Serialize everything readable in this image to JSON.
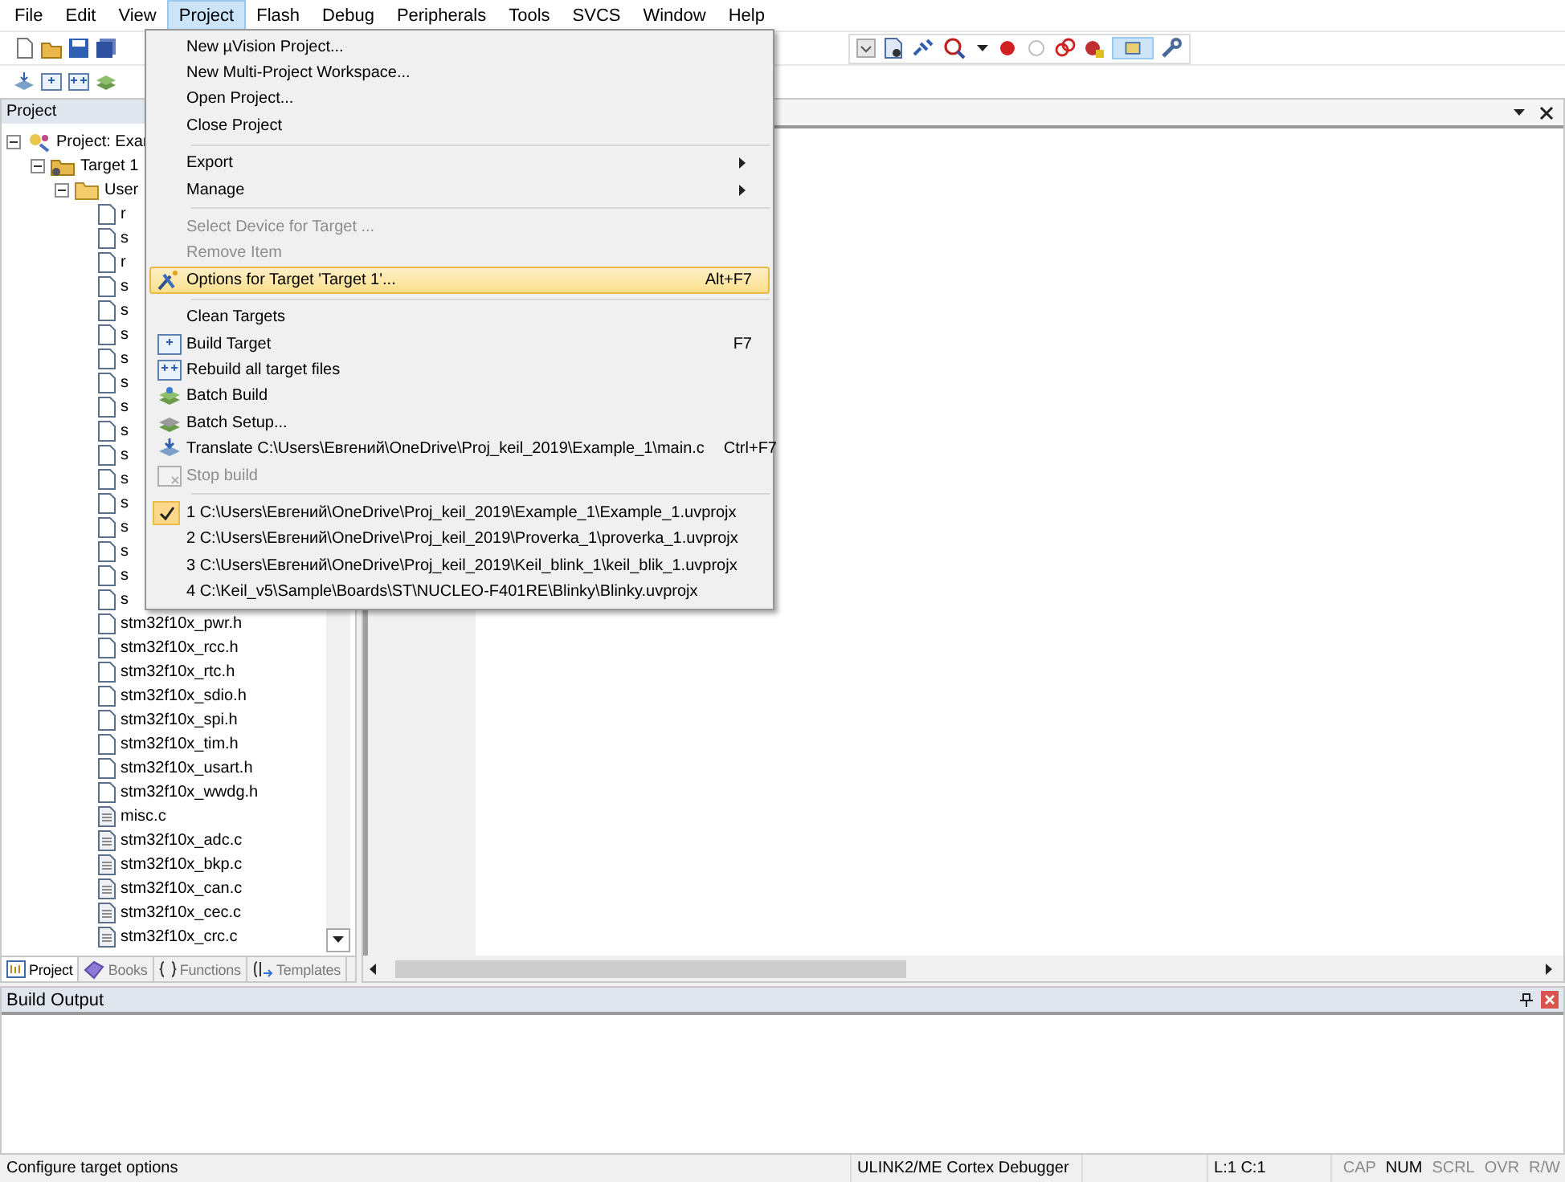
{
  "menubar": [
    {
      "label": "File",
      "selected": false
    },
    {
      "label": "Edit",
      "selected": false
    },
    {
      "label": "View",
      "selected": false
    },
    {
      "label": "Project",
      "selected": true
    },
    {
      "label": "Flash",
      "selected": false
    },
    {
      "label": "Debug",
      "selected": false
    },
    {
      "label": "Peripherals",
      "selected": false
    },
    {
      "label": "Tools",
      "selected": false
    },
    {
      "label": "SVCS",
      "selected": false
    },
    {
      "label": "Window",
      "selected": false
    },
    {
      "label": "Help",
      "selected": false
    }
  ],
  "project_panel": {
    "title": "Project",
    "tree": [
      {
        "label": "Project: Exar",
        "expanded": true,
        "kind": "project",
        "children": [
          {
            "label": "Target 1",
            "expanded": true,
            "kind": "target",
            "children": [
              {
                "label": "User",
                "expanded": true,
                "kind": "folder",
                "children": [
                  {
                    "label": "r",
                    "kind": "h"
                  },
                  {
                    "label": "s",
                    "kind": "h"
                  },
                  {
                    "label": "r",
                    "kind": "h"
                  },
                  {
                    "label": "s",
                    "kind": "h"
                  },
                  {
                    "label": "s",
                    "kind": "h"
                  },
                  {
                    "label": "s",
                    "kind": "h"
                  },
                  {
                    "label": "s",
                    "kind": "h"
                  },
                  {
                    "label": "s",
                    "kind": "h"
                  },
                  {
                    "label": "s",
                    "kind": "h"
                  },
                  {
                    "label": "s",
                    "kind": "h"
                  },
                  {
                    "label": "s",
                    "kind": "h"
                  },
                  {
                    "label": "s",
                    "kind": "h"
                  },
                  {
                    "label": "s",
                    "kind": "h"
                  },
                  {
                    "label": "s",
                    "kind": "h"
                  },
                  {
                    "label": "s",
                    "kind": "h"
                  },
                  {
                    "label": "s",
                    "kind": "h"
                  },
                  {
                    "label": "s",
                    "kind": "h"
                  },
                  {
                    "label": "stm32f10x_pwr.h",
                    "kind": "h"
                  },
                  {
                    "label": "stm32f10x_rcc.h",
                    "kind": "h"
                  },
                  {
                    "label": "stm32f10x_rtc.h",
                    "kind": "h"
                  },
                  {
                    "label": "stm32f10x_sdio.h",
                    "kind": "h"
                  },
                  {
                    "label": "stm32f10x_spi.h",
                    "kind": "h"
                  },
                  {
                    "label": "stm32f10x_tim.h",
                    "kind": "h"
                  },
                  {
                    "label": "stm32f10x_usart.h",
                    "kind": "h"
                  },
                  {
                    "label": "stm32f10x_wwdg.h",
                    "kind": "h"
                  },
                  {
                    "label": "misc.c",
                    "kind": "c"
                  },
                  {
                    "label": "stm32f10x_adc.c",
                    "kind": "c"
                  },
                  {
                    "label": "stm32f10x_bkp.c",
                    "kind": "c"
                  },
                  {
                    "label": "stm32f10x_can.c",
                    "kind": "c"
                  },
                  {
                    "label": "stm32f10x_cec.c",
                    "kind": "c"
                  },
                  {
                    "label": "stm32f10x_crc.c",
                    "kind": "c"
                  }
                ]
              }
            ]
          }
        ]
      }
    ]
  },
  "panel_tabs": [
    {
      "label": "Project",
      "selected": true,
      "kind": "project"
    },
    {
      "label": "Books",
      "selected": false,
      "kind": "books"
    },
    {
      "label": "Functions",
      "selected": false,
      "kind": "functions"
    },
    {
      "label": "Templates",
      "selected": false,
      "kind": "templates"
    }
  ],
  "project_menu": {
    "groups": [
      [
        {
          "label": "New µVision Project...",
          "disabled": false,
          "selected": false
        },
        {
          "label": "New Multi-Project Workspace...",
          "disabled": false,
          "selected": false
        },
        {
          "label": "Open Project...",
          "disabled": false,
          "selected": false
        },
        {
          "label": "Close Project",
          "disabled": false,
          "selected": false
        }
      ],
      [
        {
          "label": "Export",
          "disabled": false,
          "selected": false,
          "submenu": true
        },
        {
          "label": "Manage",
          "disabled": false,
          "selected": false,
          "submenu": true
        }
      ],
      [
        {
          "label": "Select Device for Target ...",
          "disabled": true,
          "selected": false
        },
        {
          "label": "Remove Item",
          "disabled": true,
          "selected": false
        },
        {
          "label": "Options for Target 'Target 1'...",
          "shortcut": "Alt+F7",
          "disabled": false,
          "selected": true,
          "kind": "options"
        }
      ],
      [
        {
          "label": "Clean Targets",
          "disabled": false,
          "selected": false
        },
        {
          "label": "Build Target",
          "shortcut": "F7",
          "disabled": false,
          "selected": false,
          "kind": "build"
        },
        {
          "label": "Rebuild all target files",
          "disabled": false,
          "selected": false,
          "kind": "rebuild"
        },
        {
          "label": "Batch Build",
          "disabled": false,
          "selected": false,
          "kind": "batch"
        },
        {
          "label": "Batch Setup...",
          "disabled": false,
          "selected": false,
          "kind": "batch-setup"
        },
        {
          "label": "Translate C:\\Users\\Евгений\\OneDrive\\Proj_keil_2019\\Example_1\\main.c",
          "shortcut": "Ctrl+F7",
          "disabled": false,
          "selected": false,
          "kind": "translate"
        },
        {
          "label": "Stop build",
          "disabled": true,
          "selected": false,
          "kind": "stop"
        }
      ],
      [
        {
          "label": "1 C:\\Users\\Евгений\\OneDrive\\Proj_keil_2019\\Example_1\\Example_1.uvprojx",
          "disabled": false,
          "selected": false,
          "checked": true
        },
        {
          "label": "2 C:\\Users\\Евгений\\OneDrive\\Proj_keil_2019\\Proverka_1\\proverka_1.uvprojx",
          "disabled": false,
          "selected": false,
          "checked": false
        },
        {
          "label": "3 C:\\Users\\Евгений\\OneDrive\\Proj_keil_2019\\Keil_blink_1\\keil_blik_1.uvprojx",
          "disabled": false,
          "selected": false,
          "checked": false
        },
        {
          "label": "4 C:\\Keil_v5\\Sample\\Boards\\ST\\NUCLEO-F401RE\\Blinky\\Blinky.uvprojx",
          "disabled": false,
          "selected": false,
          "checked": false
        }
      ]
    ]
  },
  "build_output": {
    "title": "Build Output"
  },
  "status_bar": {
    "hint": "Configure target options",
    "debugger": "ULINK2/ME Cortex Debugger",
    "position": "L:1 C:1",
    "indicators": [
      {
        "label": "CAP",
        "on": false
      },
      {
        "label": "NUM",
        "on": true
      },
      {
        "label": "SCRL",
        "on": false
      },
      {
        "label": "OVR",
        "on": false
      },
      {
        "label": "R/W",
        "on": false
      }
    ]
  }
}
